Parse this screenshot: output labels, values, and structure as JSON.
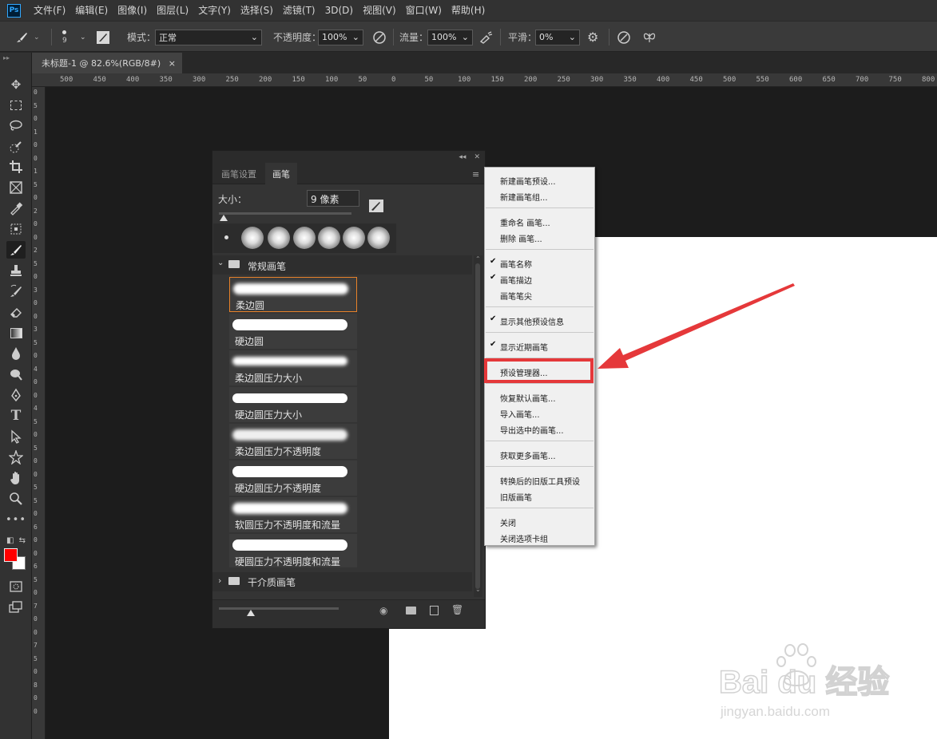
{
  "app": {
    "logo": "Ps"
  },
  "menubar": {
    "items": [
      "文件(F)",
      "编辑(E)",
      "图像(I)",
      "图层(L)",
      "文字(Y)",
      "选择(S)",
      "滤镜(T)",
      "3D(D)",
      "视图(V)",
      "窗口(W)",
      "帮助(H)"
    ]
  },
  "options": {
    "brush_size": "9",
    "mode_label": "模式：",
    "mode_value": "正常",
    "opacity_label": "不透明度：",
    "opacity_value": "100%",
    "flow_label": "流量：",
    "flow_value": "100%",
    "smooth_label": "平滑：",
    "smooth_value": "0%"
  },
  "document_tab": {
    "title": "未标题-1 @ 82.6%(RGB/8#)",
    "close": "×"
  },
  "ruler": {
    "h_labels": [
      "500",
      "450",
      "400",
      "350",
      "300",
      "250",
      "200",
      "150",
      "100",
      "50",
      "0",
      "50",
      "100",
      "150",
      "200",
      "250",
      "300",
      "350",
      "400",
      "450",
      "500",
      "550",
      "600",
      "650",
      "700",
      "750",
      "800"
    ],
    "v_digits": [
      "0",
      "5",
      "0",
      "1",
      "0",
      "0",
      "1",
      "5",
      "0",
      "2",
      "0",
      "0",
      "2",
      "5",
      "0",
      "3",
      "0",
      "0",
      "3",
      "5",
      "0",
      "4",
      "0",
      "0",
      "4",
      "5",
      "0",
      "5",
      "0",
      "0",
      "5",
      "5",
      "0",
      "6",
      "0",
      "0",
      "6",
      "5",
      "0",
      "7",
      "0",
      "0",
      "7",
      "5",
      "0",
      "8",
      "0",
      "0"
    ]
  },
  "panel": {
    "tabs": [
      "画笔设置",
      "画笔"
    ],
    "active_tab": 1,
    "size_label": "大小：",
    "size_value": "9 像素",
    "group_name": "常规画笔",
    "group2_name": "干介质画笔",
    "brushes": [
      "柔边圆",
      "硬边圆",
      "柔边圆压力大小",
      "硬边圆压力大小",
      "柔边圆压力不透明度",
      "硬边圆压力不透明度",
      "软圆压力不透明度和流量",
      "硬圆压力不透明度和流量"
    ],
    "selected_brush": 0
  },
  "context_menu": {
    "items": [
      {
        "label": "新建画笔预设...",
        "checked": false
      },
      {
        "label": "新建画笔组...",
        "checked": false
      },
      {
        "label": "重命名 画笔...",
        "checked": false
      },
      {
        "label": "删除 画笔...",
        "checked": false
      },
      {
        "label": "画笔名称",
        "checked": true
      },
      {
        "label": "画笔描边",
        "checked": true
      },
      {
        "label": "画笔笔尖",
        "checked": false
      },
      {
        "label": "显示其他预设信息",
        "checked": true
      },
      {
        "label": "显示近期画笔",
        "checked": true
      },
      {
        "label": "预设管理器...",
        "checked": false
      },
      {
        "label": "恢复默认画笔...",
        "checked": false
      },
      {
        "label": "导入画笔...",
        "checked": false
      },
      {
        "label": "导出选中的画笔...",
        "checked": false
      },
      {
        "label": "获取更多画笔...",
        "checked": false
      },
      {
        "label": "转换后的旧版工具预设",
        "checked": false
      },
      {
        "label": "旧版画笔",
        "checked": false
      },
      {
        "label": "关闭",
        "checked": false
      },
      {
        "label": "关闭选项卡组",
        "checked": false
      }
    ],
    "highlighted": "预设管理器..."
  },
  "colors": {
    "foreground": "#ff0000",
    "background": "#ffffff",
    "annotation": "#e5383a"
  },
  "watermark": {
    "brand": "Bai du 经验",
    "url": "jingyan.baidu.com"
  }
}
